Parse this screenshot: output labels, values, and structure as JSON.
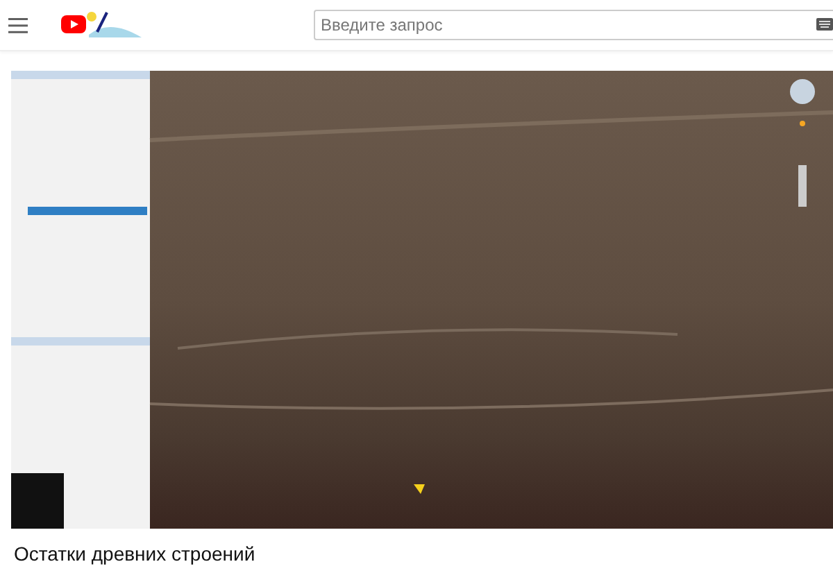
{
  "header": {
    "search": {
      "placeholder": "Введите запрос"
    }
  },
  "video": {
    "title": "Остатки древних строений"
  }
}
